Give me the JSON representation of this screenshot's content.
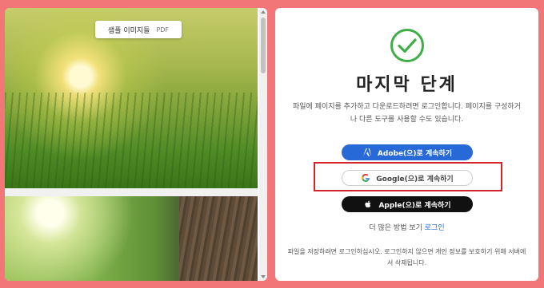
{
  "preview": {
    "sample_label": "샘플 이미지들",
    "file_type": "PDF"
  },
  "signin": {
    "title": "마지막 단계",
    "description": "파일에 페이지를 추가하고 다운로드하려면 로그인합니다. 페이지를 구성하거나 다른 도구를 사용할 수도 있습니다.",
    "adobe_button": "Adobe(으)로 계속하기",
    "google_button": "Google(으)로 계속하기",
    "apple_button": "Apple(으)로 계속하기",
    "more_methods": "더 많은 방법 보기",
    "login_link": "로그인",
    "footer_note": "파일을 저장하려면 로그인하십시오. 로그인하지 않으면 개인 정보를 보호하기 위해 서버에서 삭제됩니다."
  },
  "colors": {
    "background": "#f27678",
    "accent_blue": "#2769d6",
    "check_green": "#3fae49",
    "highlight_red": "#d4232b"
  },
  "icons": [
    "checkmark-circle-icon",
    "adobe-logo-icon",
    "google-logo-icon",
    "apple-logo-icon"
  ]
}
